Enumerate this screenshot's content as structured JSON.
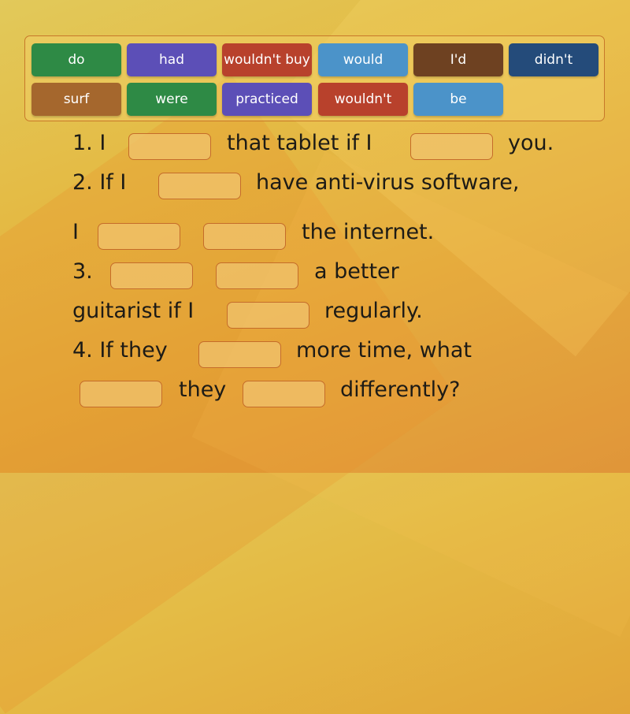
{
  "word_bank": [
    {
      "label": "do",
      "color": "#2e8a45"
    },
    {
      "label": "had",
      "color": "#5c4fb7"
    },
    {
      "label": "wouldn't buy",
      "color": "#b8412c"
    },
    {
      "label": "would",
      "color": "#4b93c9"
    },
    {
      "label": "I'd",
      "color": "#6e4121"
    },
    {
      "label": "didn't",
      "color": "#244b7a"
    },
    {
      "label": "surf",
      "color": "#a5672d"
    },
    {
      "label": "were",
      "color": "#2e8a45"
    },
    {
      "label": "practiced",
      "color": "#5c4fb7"
    },
    {
      "label": "wouldn't",
      "color": "#b8412c"
    },
    {
      "label": "be",
      "color": "#4b93c9"
    }
  ],
  "sentences": {
    "s1": {
      "part1": "1. I",
      "part2": "that tablet if I",
      "part3": "you."
    },
    "s2": {
      "part1": "2. If I",
      "part2": "have anti-virus software,",
      "part3": "I",
      "part4": "the internet."
    },
    "s3": {
      "part1": "3.",
      "part2": "a better",
      "part3": "guitarist if I",
      "part4": "regularly."
    },
    "s4": {
      "part1": "4. If they",
      "part2": "more time, what",
      "part3": "they",
      "part4": "differently?"
    }
  }
}
